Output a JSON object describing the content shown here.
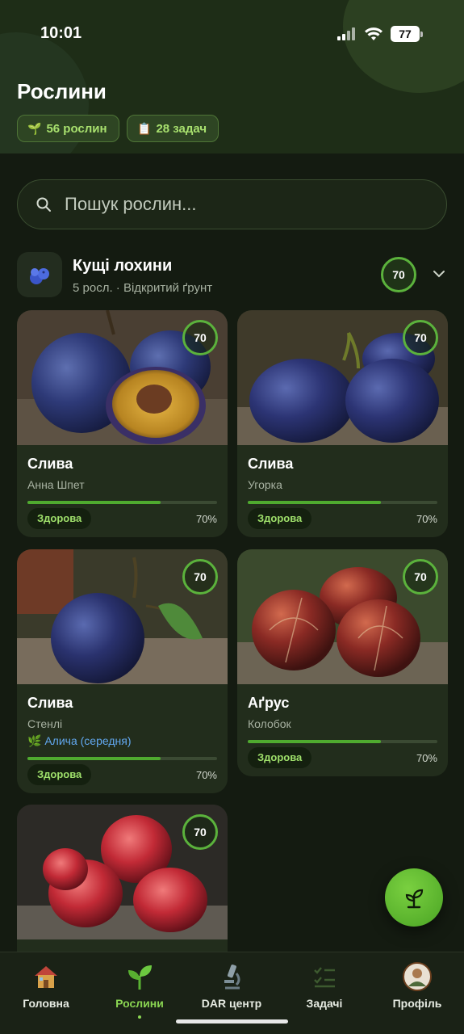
{
  "status_bar": {
    "time": "10:01",
    "battery": "77"
  },
  "header": {
    "title": "Рослини",
    "plants_badge": "56 рослин",
    "tasks_badge": "28 задач"
  },
  "search": {
    "placeholder": "Пошук рослин..."
  },
  "group": {
    "title": "Кущі лохини",
    "subtitle": "5 росл. · Відкритий ґрунт",
    "score": "70"
  },
  "cards": [
    {
      "name": "Слива",
      "variety": "Анна Шпет",
      "status": "Здорова",
      "percent": "70%",
      "score": "70",
      "health": 0.7,
      "image": "plum-halved"
    },
    {
      "name": "Слива",
      "variety": "Угорка",
      "status": "Здорова",
      "percent": "70%",
      "score": "70",
      "health": 0.7,
      "image": "plums"
    },
    {
      "name": "Слива",
      "variety": "Стенлі",
      "rootstock": "Алича (середня)",
      "status": "Здорова",
      "percent": "70%",
      "score": "70",
      "health": 0.7,
      "image": "plum-branch"
    },
    {
      "name": "Аґрус",
      "variety": "Колобок",
      "status": "Здорова",
      "percent": "70%",
      "score": "70",
      "health": 0.7,
      "image": "gooseberries"
    },
    {
      "score": "70",
      "image": "raspberries"
    }
  ],
  "nav": [
    {
      "label": "Головна",
      "icon": "house-icon"
    },
    {
      "label": "Рослини",
      "icon": "sprout-icon",
      "active": true
    },
    {
      "label": "DAR центр",
      "icon": "microscope-icon"
    },
    {
      "label": "Задачі",
      "icon": "checklist-icon"
    },
    {
      "label": "Профіль",
      "icon": "avatar-icon"
    }
  ],
  "colors": {
    "accent": "#8bd652",
    "background": "#141b11",
    "card": "#222d1c"
  }
}
